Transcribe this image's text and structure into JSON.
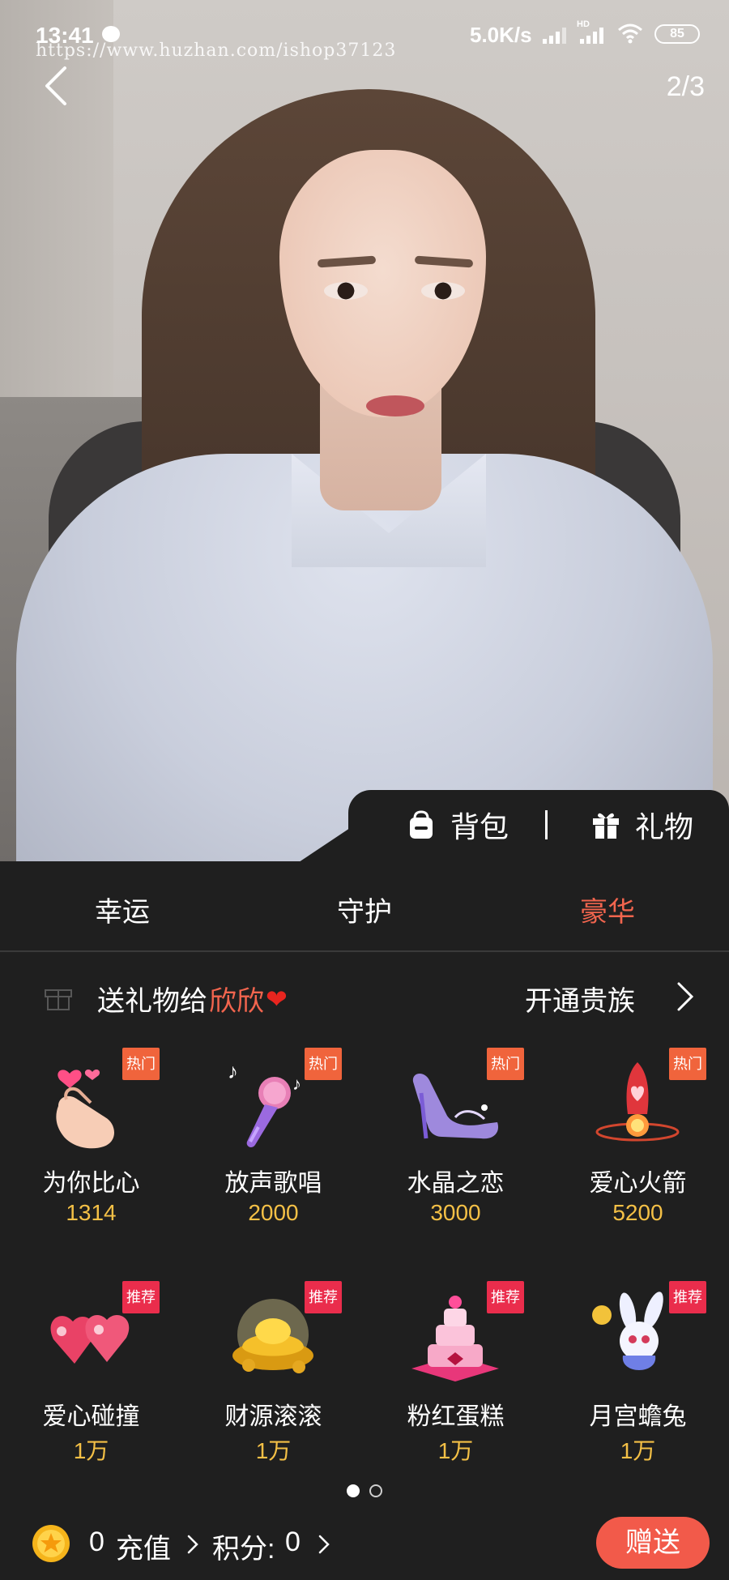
{
  "status_bar": {
    "time": "13:41",
    "watermark": "https://www.huzhan.com/ishop37123",
    "net_speed": "5.0K/s",
    "hd_label": "HD",
    "battery": "85"
  },
  "nav": {
    "pager": "2/3"
  },
  "panel_tabs": {
    "bag": "背包",
    "gifts": "礼物"
  },
  "categories": [
    {
      "label": "幸运",
      "active": false
    },
    {
      "label": "守护",
      "active": false
    },
    {
      "label": "豪华",
      "active": true
    }
  ],
  "send_to": {
    "prefix": "送礼物给",
    "recipient": "欣欣",
    "heart": "❤",
    "noble_link": "开通贵族"
  },
  "gifts": [
    {
      "name": "为你比心",
      "price": "1314",
      "badge": "热门",
      "badge_type": "hot",
      "icon": "finger-heart-icon"
    },
    {
      "name": "放声歌唱",
      "price": "2000",
      "badge": "热门",
      "badge_type": "hot",
      "icon": "microphone-icon"
    },
    {
      "name": "水晶之恋",
      "price": "3000",
      "badge": "热门",
      "badge_type": "hot",
      "icon": "crystal-shoe-icon"
    },
    {
      "name": "爱心火箭",
      "price": "5200",
      "badge": "热门",
      "badge_type": "hot",
      "icon": "heart-rocket-icon"
    },
    {
      "name": "爱心碰撞",
      "price": "1万",
      "badge": "推荐",
      "badge_type": "rec",
      "icon": "twin-hearts-icon"
    },
    {
      "name": "财源滚滚",
      "price": "1万",
      "badge": "推荐",
      "badge_type": "rec",
      "icon": "gold-ingots-icon"
    },
    {
      "name": "粉红蛋糕",
      "price": "1万",
      "badge": "推荐",
      "badge_type": "rec",
      "icon": "pink-cake-icon"
    },
    {
      "name": "月宫蟾兔",
      "price": "1万",
      "badge": "推荐",
      "badge_type": "rec",
      "icon": "moon-rabbit-icon"
    }
  ],
  "pagination": {
    "current": 1,
    "total": 2
  },
  "wallet": {
    "coins": "0",
    "recharge": "充值",
    "points_label": "积分:",
    "points": "0"
  },
  "send_button": "赠送",
  "colors": {
    "accent": "#f2654e",
    "price": "#f4c046",
    "hot_badge": "#f0643c",
    "rec_badge": "#ea2d4c",
    "send_button": "#f25a4a",
    "panel_bg": "#1f1f1f"
  }
}
